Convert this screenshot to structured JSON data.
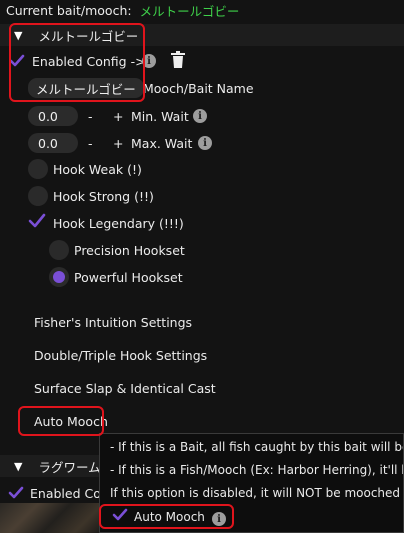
{
  "current": {
    "label": "Current bait/mooch:",
    "value": "メルトールゴビー"
  },
  "section1": {
    "title": "メルトールゴビー",
    "enabled_label": "Enabled Config ->",
    "name_button": "メルトールゴビー",
    "name_label": "Mooch/Bait Name",
    "min_wait": {
      "value": "0.0",
      "minus": "-",
      "plus": "+",
      "label": "Min. Wait"
    },
    "max_wait": {
      "value": "0.0",
      "minus": "-",
      "plus": "+",
      "label": "Max. Wait"
    },
    "hooks": [
      {
        "label": "Hook Weak (!)",
        "checked": false
      },
      {
        "label": "Hook Strong (!!)",
        "checked": false
      },
      {
        "label": "Hook Legendary (!!!)",
        "checked": true
      }
    ],
    "hooksets": [
      {
        "label": "Precision Hookset",
        "selected": false
      },
      {
        "label": "Powerful Hookset",
        "selected": true
      }
    ],
    "settings": [
      "Fisher's Intuition Settings",
      "Double/Triple Hook Settings",
      "Surface Slap & Identical Cast",
      "Auto Mooch"
    ]
  },
  "section2": {
    "title": "ラグワーム",
    "enabled_label": "Enabled Conf"
  },
  "tooltip": {
    "lines": [
      "- If this is a Bait, all fish caught by this bait will be mo",
      "- If this is a Fish/Mooch (Ex: Harbor Herring), it'll be m",
      "If this option is disabled, it will NOT be mooched ever"
    ],
    "checkbox_label": "Auto Mooch"
  },
  "colors": {
    "accent_green": "#3fd04a",
    "check_purple": "#7a4fd6",
    "highlight_red": "#e0141c"
  }
}
